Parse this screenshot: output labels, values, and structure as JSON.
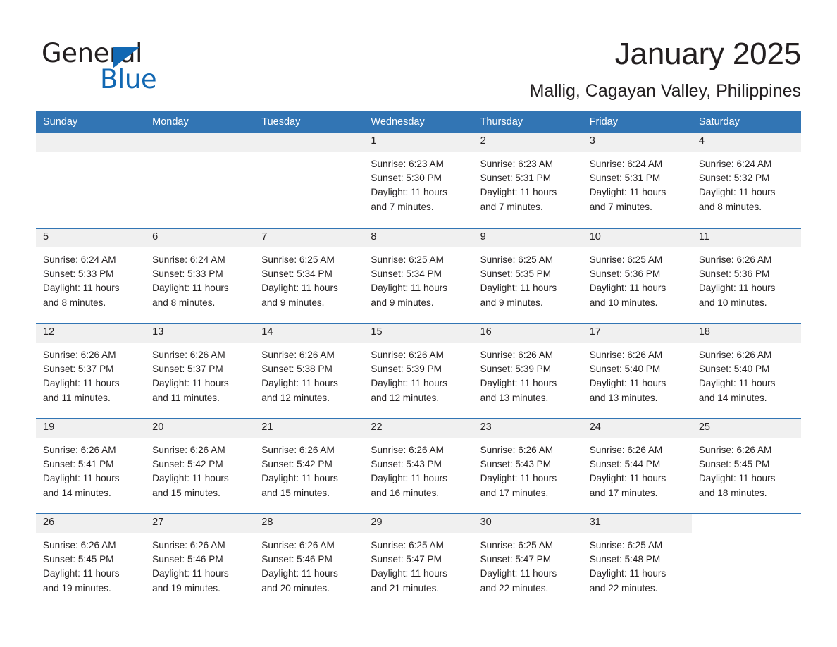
{
  "brand": {
    "name_part1": "General",
    "name_part2": "Blue",
    "triangle_color": "#1268b3",
    "text_color": "#231f20"
  },
  "header": {
    "title": "January 2025",
    "location": "Mallig, Cagayan Valley, Philippines"
  },
  "theme": {
    "accent": "#3275b4",
    "header_text": "#ffffff",
    "daynum_band": "#f0f0f0",
    "body_text": "#231f20"
  },
  "weekday_headers": [
    "Sunday",
    "Monday",
    "Tuesday",
    "Wednesday",
    "Thursday",
    "Friday",
    "Saturday"
  ],
  "labels": {
    "sunrise_prefix": "Sunrise:",
    "sunset_prefix": "Sunset:",
    "daylight_prefix": "Daylight:"
  },
  "weeks": [
    [
      {
        "day": "",
        "sunrise": "",
        "sunset": "",
        "daylight_line1": "",
        "daylight_line2": "",
        "empty": true
      },
      {
        "day": "",
        "sunrise": "",
        "sunset": "",
        "daylight_line1": "",
        "daylight_line2": "",
        "empty": true
      },
      {
        "day": "",
        "sunrise": "",
        "sunset": "",
        "daylight_line1": "",
        "daylight_line2": "",
        "empty": true
      },
      {
        "day": "1",
        "sunrise": "Sunrise: 6:23 AM",
        "sunset": "Sunset: 5:30 PM",
        "daylight_line1": "Daylight: 11 hours",
        "daylight_line2": "and 7 minutes."
      },
      {
        "day": "2",
        "sunrise": "Sunrise: 6:23 AM",
        "sunset": "Sunset: 5:31 PM",
        "daylight_line1": "Daylight: 11 hours",
        "daylight_line2": "and 7 minutes."
      },
      {
        "day": "3",
        "sunrise": "Sunrise: 6:24 AM",
        "sunset": "Sunset: 5:31 PM",
        "daylight_line1": "Daylight: 11 hours",
        "daylight_line2": "and 7 minutes."
      },
      {
        "day": "4",
        "sunrise": "Sunrise: 6:24 AM",
        "sunset": "Sunset: 5:32 PM",
        "daylight_line1": "Daylight: 11 hours",
        "daylight_line2": "and 8 minutes."
      }
    ],
    [
      {
        "day": "5",
        "sunrise": "Sunrise: 6:24 AM",
        "sunset": "Sunset: 5:33 PM",
        "daylight_line1": "Daylight: 11 hours",
        "daylight_line2": "and 8 minutes."
      },
      {
        "day": "6",
        "sunrise": "Sunrise: 6:24 AM",
        "sunset": "Sunset: 5:33 PM",
        "daylight_line1": "Daylight: 11 hours",
        "daylight_line2": "and 8 minutes."
      },
      {
        "day": "7",
        "sunrise": "Sunrise: 6:25 AM",
        "sunset": "Sunset: 5:34 PM",
        "daylight_line1": "Daylight: 11 hours",
        "daylight_line2": "and 9 minutes."
      },
      {
        "day": "8",
        "sunrise": "Sunrise: 6:25 AM",
        "sunset": "Sunset: 5:34 PM",
        "daylight_line1": "Daylight: 11 hours",
        "daylight_line2": "and 9 minutes."
      },
      {
        "day": "9",
        "sunrise": "Sunrise: 6:25 AM",
        "sunset": "Sunset: 5:35 PM",
        "daylight_line1": "Daylight: 11 hours",
        "daylight_line2": "and 9 minutes."
      },
      {
        "day": "10",
        "sunrise": "Sunrise: 6:25 AM",
        "sunset": "Sunset: 5:36 PM",
        "daylight_line1": "Daylight: 11 hours",
        "daylight_line2": "and 10 minutes."
      },
      {
        "day": "11",
        "sunrise": "Sunrise: 6:26 AM",
        "sunset": "Sunset: 5:36 PM",
        "daylight_line1": "Daylight: 11 hours",
        "daylight_line2": "and 10 minutes."
      }
    ],
    [
      {
        "day": "12",
        "sunrise": "Sunrise: 6:26 AM",
        "sunset": "Sunset: 5:37 PM",
        "daylight_line1": "Daylight: 11 hours",
        "daylight_line2": "and 11 minutes."
      },
      {
        "day": "13",
        "sunrise": "Sunrise: 6:26 AM",
        "sunset": "Sunset: 5:37 PM",
        "daylight_line1": "Daylight: 11 hours",
        "daylight_line2": "and 11 minutes."
      },
      {
        "day": "14",
        "sunrise": "Sunrise: 6:26 AM",
        "sunset": "Sunset: 5:38 PM",
        "daylight_line1": "Daylight: 11 hours",
        "daylight_line2": "and 12 minutes."
      },
      {
        "day": "15",
        "sunrise": "Sunrise: 6:26 AM",
        "sunset": "Sunset: 5:39 PM",
        "daylight_line1": "Daylight: 11 hours",
        "daylight_line2": "and 12 minutes."
      },
      {
        "day": "16",
        "sunrise": "Sunrise: 6:26 AM",
        "sunset": "Sunset: 5:39 PM",
        "daylight_line1": "Daylight: 11 hours",
        "daylight_line2": "and 13 minutes."
      },
      {
        "day": "17",
        "sunrise": "Sunrise: 6:26 AM",
        "sunset": "Sunset: 5:40 PM",
        "daylight_line1": "Daylight: 11 hours",
        "daylight_line2": "and 13 minutes."
      },
      {
        "day": "18",
        "sunrise": "Sunrise: 6:26 AM",
        "sunset": "Sunset: 5:40 PM",
        "daylight_line1": "Daylight: 11 hours",
        "daylight_line2": "and 14 minutes."
      }
    ],
    [
      {
        "day": "19",
        "sunrise": "Sunrise: 6:26 AM",
        "sunset": "Sunset: 5:41 PM",
        "daylight_line1": "Daylight: 11 hours",
        "daylight_line2": "and 14 minutes."
      },
      {
        "day": "20",
        "sunrise": "Sunrise: 6:26 AM",
        "sunset": "Sunset: 5:42 PM",
        "daylight_line1": "Daylight: 11 hours",
        "daylight_line2": "and 15 minutes."
      },
      {
        "day": "21",
        "sunrise": "Sunrise: 6:26 AM",
        "sunset": "Sunset: 5:42 PM",
        "daylight_line1": "Daylight: 11 hours",
        "daylight_line2": "and 15 minutes."
      },
      {
        "day": "22",
        "sunrise": "Sunrise: 6:26 AM",
        "sunset": "Sunset: 5:43 PM",
        "daylight_line1": "Daylight: 11 hours",
        "daylight_line2": "and 16 minutes."
      },
      {
        "day": "23",
        "sunrise": "Sunrise: 6:26 AM",
        "sunset": "Sunset: 5:43 PM",
        "daylight_line1": "Daylight: 11 hours",
        "daylight_line2": "and 17 minutes."
      },
      {
        "day": "24",
        "sunrise": "Sunrise: 6:26 AM",
        "sunset": "Sunset: 5:44 PM",
        "daylight_line1": "Daylight: 11 hours",
        "daylight_line2": "and 17 minutes."
      },
      {
        "day": "25",
        "sunrise": "Sunrise: 6:26 AM",
        "sunset": "Sunset: 5:45 PM",
        "daylight_line1": "Daylight: 11 hours",
        "daylight_line2": "and 18 minutes."
      }
    ],
    [
      {
        "day": "26",
        "sunrise": "Sunrise: 6:26 AM",
        "sunset": "Sunset: 5:45 PM",
        "daylight_line1": "Daylight: 11 hours",
        "daylight_line2": "and 19 minutes."
      },
      {
        "day": "27",
        "sunrise": "Sunrise: 6:26 AM",
        "sunset": "Sunset: 5:46 PM",
        "daylight_line1": "Daylight: 11 hours",
        "daylight_line2": "and 19 minutes."
      },
      {
        "day": "28",
        "sunrise": "Sunrise: 6:26 AM",
        "sunset": "Sunset: 5:46 PM",
        "daylight_line1": "Daylight: 11 hours",
        "daylight_line2": "and 20 minutes."
      },
      {
        "day": "29",
        "sunrise": "Sunrise: 6:25 AM",
        "sunset": "Sunset: 5:47 PM",
        "daylight_line1": "Daylight: 11 hours",
        "daylight_line2": "and 21 minutes."
      },
      {
        "day": "30",
        "sunrise": "Sunrise: 6:25 AM",
        "sunset": "Sunset: 5:47 PM",
        "daylight_line1": "Daylight: 11 hours",
        "daylight_line2": "and 22 minutes."
      },
      {
        "day": "31",
        "sunrise": "Sunrise: 6:25 AM",
        "sunset": "Sunset: 5:48 PM",
        "daylight_line1": "Daylight: 11 hours",
        "daylight_line2": "and 22 minutes."
      },
      {
        "day": "",
        "sunrise": "",
        "sunset": "",
        "daylight_line1": "",
        "daylight_line2": "",
        "blank": true
      }
    ]
  ]
}
